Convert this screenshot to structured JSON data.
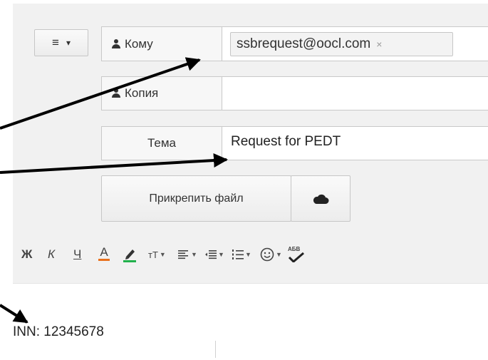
{
  "menu_button": {
    "icon": "≡",
    "caret": "▾"
  },
  "to": {
    "label": "Кому",
    "recipient": "ssbrequest@oocl.com",
    "remove": "×"
  },
  "cc": {
    "label": "Копия",
    "value": ""
  },
  "subject": {
    "label": "Тема",
    "value": "Request for PEDT"
  },
  "attach": {
    "label": "Прикрепить файл"
  },
  "toolbar": {
    "bold": "Ж",
    "italic": "К",
    "underline": "Ч",
    "text_color": "А",
    "font_size": "тТ",
    "spell": "АБВ"
  },
  "body": {
    "text": "INN: 12345678"
  },
  "colors": {
    "text_color_bar": "#e8711d",
    "highlight_bar": "#22b14c",
    "arrow": "#000000"
  }
}
